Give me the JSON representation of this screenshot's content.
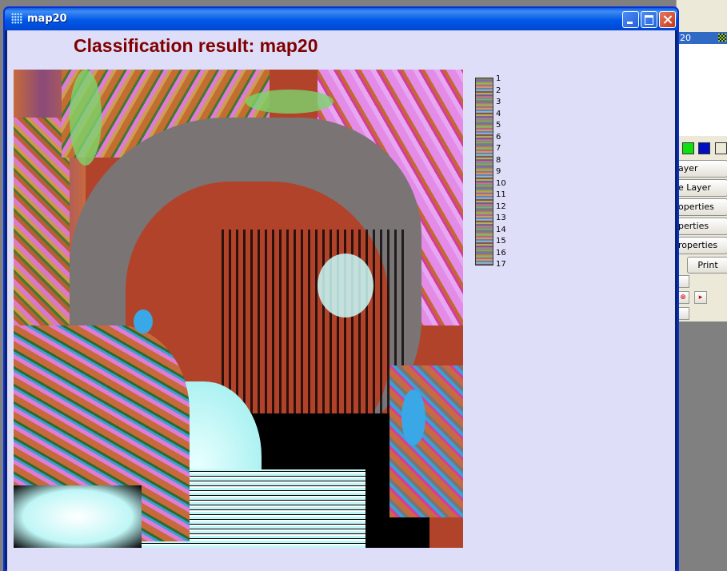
{
  "window": {
    "title": "map20",
    "controls": [
      "minimize-button",
      "maximize-button",
      "close-button"
    ]
  },
  "map": {
    "title": "Classification result: map20",
    "legend": [
      "1",
      "2",
      "3",
      "4",
      "5",
      "6",
      "7",
      "8",
      "9",
      "10",
      "11",
      "12",
      "13",
      "14",
      "15",
      "16",
      "17"
    ]
  },
  "background_panel": {
    "selected_row": "20",
    "buttons": [
      "ayer",
      "e Layer",
      "operties",
      "perties",
      "roperties"
    ],
    "print_label": "Print",
    "swatch_colors": [
      "#10e010",
      "#0010c0"
    ]
  }
}
